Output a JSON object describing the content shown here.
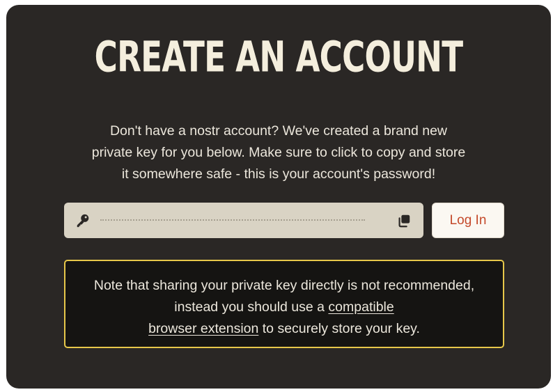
{
  "modal": {
    "title": "CREATE AN ACCOUNT",
    "intro_line1": "Don't have a nostr account? We've created a brand new",
    "intro_line2": "private key for you below. Make sure to click to copy and store",
    "intro_line3": "it somewhere safe - this is your account's password!"
  },
  "key_field": {
    "icon": "key-icon",
    "value_masked": "",
    "copy_icon": "copy-icon"
  },
  "login_button": {
    "label": "Log In"
  },
  "note": {
    "text_before": "Note that sharing your private key directly is not recommended, instead you should use a ",
    "link_part1": "compatible",
    "link_part2": "browser extension",
    "text_after": " to securely store your key."
  },
  "colors": {
    "background": "#2a2725",
    "title": "#f4eedd",
    "key_field_bg": "#d9d3c4",
    "login_text": "#c4492a",
    "note_border": "#e7c84a",
    "note_bg": "#151412"
  }
}
